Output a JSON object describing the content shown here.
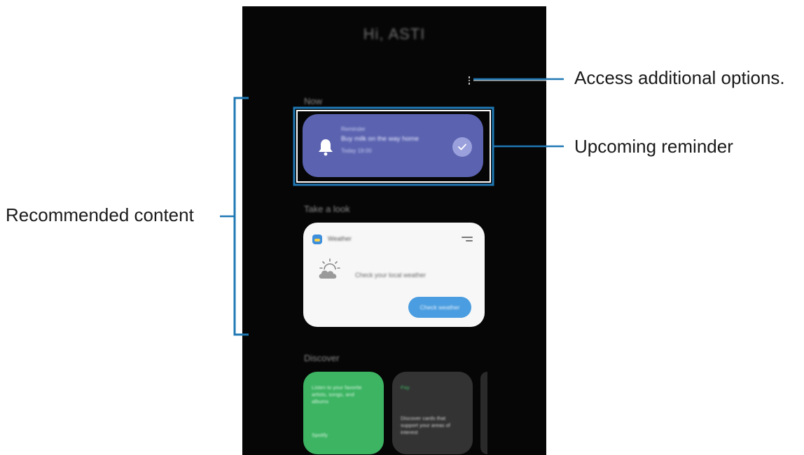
{
  "phone": {
    "greeting": "Hi, ASTI",
    "sections": {
      "now": "Now",
      "take_a_look": "Take a look",
      "discover": "Discover"
    },
    "reminder_card": {
      "category": "Reminder",
      "title": "Buy milk on the way home",
      "time": "Today 19:00",
      "icon": "bell-icon",
      "check_icon": "check-icon",
      "color": "#5b63b0"
    },
    "weather_card": {
      "app": "Weather",
      "message": "Check your local weather",
      "button": "Check weather",
      "icon": "partly-cloudy-icon"
    },
    "discover_cards": [
      {
        "text": "Listen to your favorite artists, songs, and albums",
        "source": "Spotify",
        "color": "#3cb462"
      },
      {
        "header": "Pay",
        "text": "Discover cards that support your areas of interest",
        "color": "#333333"
      }
    ]
  },
  "callouts": {
    "options": "Access additional options.",
    "reminder": "Upcoming reminder",
    "recommended": "Recommended content"
  },
  "colors": {
    "callout_line": "#1f78b4",
    "screen_bg": "#060606"
  }
}
